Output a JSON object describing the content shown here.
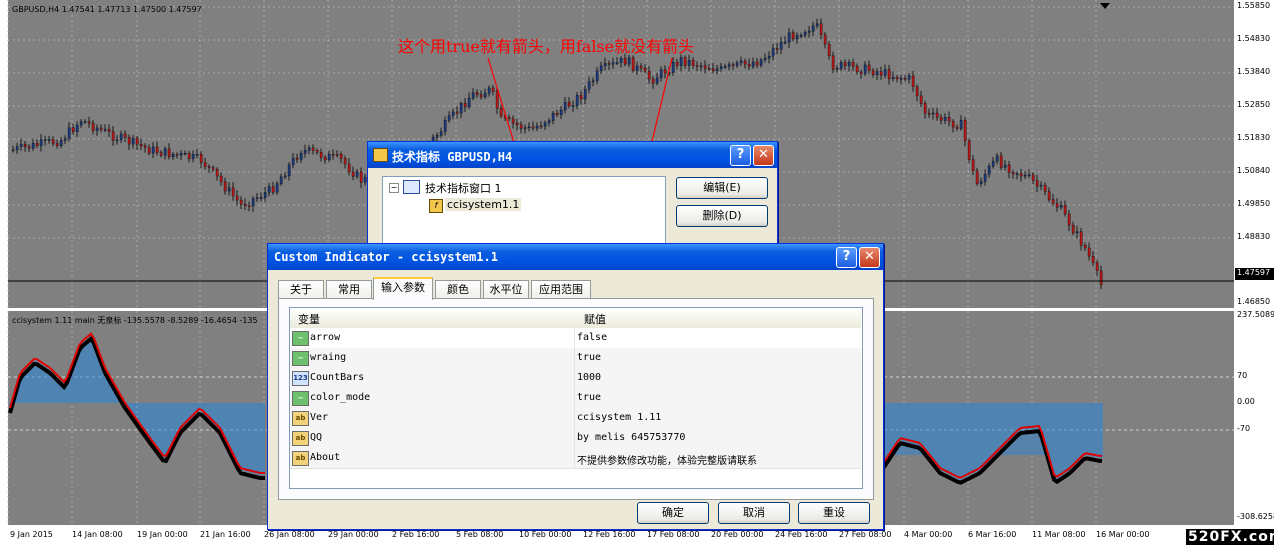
{
  "chart": {
    "symbol_header": "GBPUSD,H4  1.47541 1.47713 1.47500 1.47597",
    "indicator_header": "ccisystem 1.11 main 无泉标 -135.5578 -8.5289 -16.4654 -135",
    "price_labels": [
      "1.55850",
      "1.54830",
      "1.53840",
      "1.52850",
      "1.51830",
      "1.50840",
      "1.49850",
      "1.48830",
      "1.46850"
    ],
    "current_price": "1.47597",
    "osc_labels": [
      "237.5089",
      "70",
      "0.00",
      "-70",
      "-308.6258"
    ],
    "time_labels": [
      "9 Jan 2015",
      "14 Jan 08:00",
      "19 Jan 00:00",
      "21 Jan 16:00",
      "26 Jan 08:00",
      "29 Jan 00:00",
      "2 Feb 16:00",
      "5 Feb 08:00",
      "10 Feb 00:00",
      "12 Feb 16:00",
      "17 Feb 08:00",
      "20 Feb 00:00",
      "24 Feb 16:00",
      "27 Feb 08:00",
      "4 Mar 00:00",
      "6 Mar 16:00",
      "11 Mar 08:00",
      "16 Mar 00:00"
    ],
    "annotation": "这个用true就有箭头，用false就没有箭头",
    "watermark": "520FX.com"
  },
  "tech_dialog": {
    "title": "技术指标 GBPUSD,H4",
    "tree_root": "技术指标窗口 1",
    "tree_child": "ccisystem1.1",
    "edit_button": "编辑(E)",
    "delete_button": "删除(D)"
  },
  "custom_dialog": {
    "title": "Custom Indicator - ccisystem1.1",
    "tabs": [
      "关于",
      "常用",
      "输入参数",
      "颜色",
      "水平位",
      "应用范围"
    ],
    "columns": [
      "变量",
      "赋值"
    ],
    "rows": [
      {
        "type": "bool",
        "name": "arrow",
        "value": "false"
      },
      {
        "type": "bool",
        "name": "wraing",
        "value": "true"
      },
      {
        "type": "int",
        "name": "CountBars",
        "value": "1000"
      },
      {
        "type": "bool",
        "name": "color_mode",
        "value": "true"
      },
      {
        "type": "string",
        "name": "Ver",
        "value": "ccisystem 1.11"
      },
      {
        "type": "string",
        "name": "QQ",
        "value": "by melis 645753770"
      },
      {
        "type": "string",
        "name": "About",
        "value": "不提供参数修改功能，体验完整版请联系"
      }
    ],
    "type_icon_text": {
      "bool": "~",
      "int": "123",
      "string": "ab"
    },
    "ok_button": "确定",
    "cancel_button": "取消",
    "reset_button": "重设"
  },
  "colors": {
    "chart_bg": "#808080",
    "bear_candle": "#b01818",
    "bull_candle": "#1c3a7a",
    "osc_fill": "#1e88e5",
    "osc_signal": "#e00000",
    "osc_main": "#000000",
    "annotation": "#ff0000"
  }
}
